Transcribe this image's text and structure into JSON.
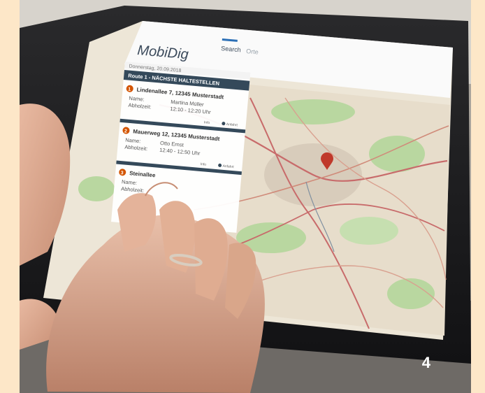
{
  "image_number": "4",
  "app": {
    "title": "MobiDig",
    "nav_search": "Search",
    "nav_other": "Orte"
  },
  "panel": {
    "date": "Donnerstag, 20.09.2018",
    "header": "Route 1 - NÄCHSTE HALTESTELLEN",
    "stops": [
      {
        "number": "1",
        "address": "Lindenallee 7, 12345 Musterstadt",
        "name_label": "Name:",
        "name_value": "Martina Müller",
        "pickup_label": "Abholzeit:",
        "pickup_value": "12:10 - 12:20 Uhr",
        "action1": "Info",
        "action2": "Anfahrt"
      },
      {
        "number": "2",
        "address": "Mauerweg 12, 12345 Musterstadt",
        "name_label": "Name:",
        "name_value": "Otto Ernst",
        "pickup_label": "Abholzeit:",
        "pickup_value": "12:40 - 12:50 Uhr",
        "action1": "Info",
        "action2": "Anfahrt"
      },
      {
        "number": "3",
        "address": "Steinallee",
        "name_label": "Name:",
        "pickup_label": "Abholzeit:"
      }
    ]
  },
  "colors": {
    "background_frame": "#fde7c8",
    "header_dark": "#34495a",
    "stop_marker": "#d35400",
    "map_base": "#ede6d7",
    "map_green": "#b9d7a0",
    "road_red": "#c86b6b"
  }
}
